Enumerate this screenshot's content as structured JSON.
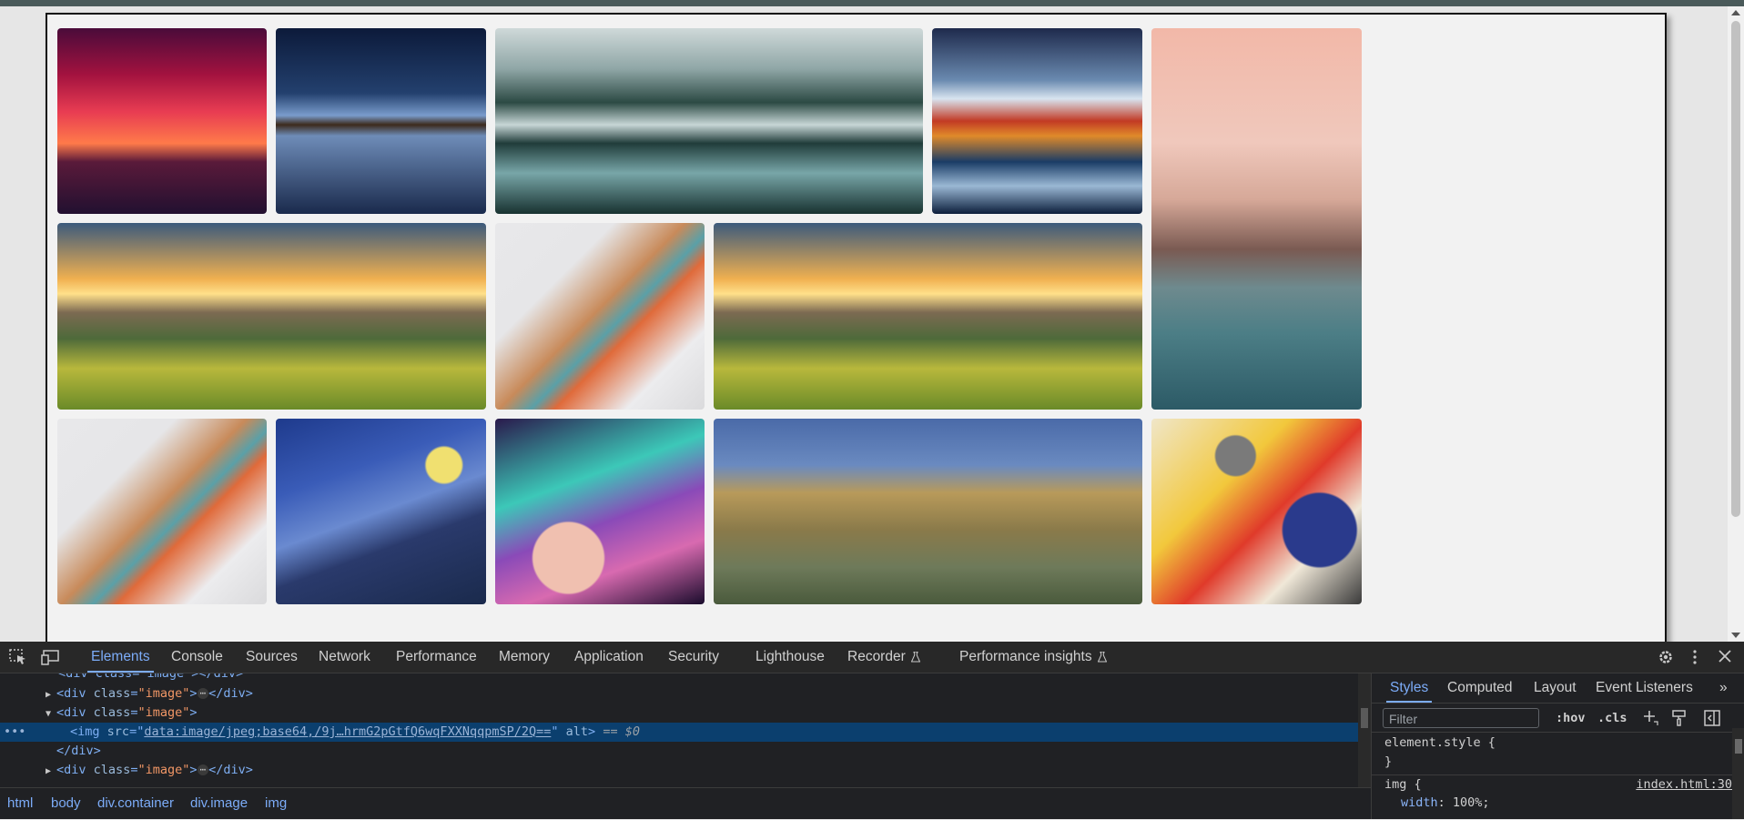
{
  "gallery": {
    "images": [
      {
        "name": "sunset-tree-image",
        "art": "im-sunset-tree"
      },
      {
        "name": "night-tree-reflection-image",
        "art": "im-night-tree"
      },
      {
        "name": "mountain-lake-reflection-image",
        "art": "im-lake-mtn"
      },
      {
        "name": "mount-fuji-lake-image",
        "art": "im-fuji"
      },
      {
        "name": "taj-mahal-image",
        "art": "im-taj"
      },
      {
        "name": "sunrise-meadow-image",
        "art": "im-meadow"
      },
      {
        "name": "reaching-hands-sketch-image",
        "art": "im-hands"
      },
      {
        "name": "sunrise-meadow-image-2",
        "art": "im-meadow"
      },
      {
        "name": "reaching-hands-sketch-image-2",
        "art": "im-hands"
      },
      {
        "name": "starry-night-image",
        "art": "im-starry"
      },
      {
        "name": "teal-haired-girl-image",
        "art": "im-girl"
      },
      {
        "name": "church-painting-image",
        "art": "im-church"
      },
      {
        "name": "kandinsky-abstract-image",
        "art": "im-kandinsky"
      }
    ]
  },
  "devtools": {
    "tabs": [
      "Elements",
      "Console",
      "Sources",
      "Network",
      "Performance",
      "Memory",
      "Application",
      "Security",
      "Lighthouse",
      "Recorder",
      "Performance insights"
    ],
    "active_tab": "Elements",
    "dom": {
      "line_partial": "<div class=\"image\"></div>",
      "div_open": "div",
      "class_attr": "class",
      "image_value": "\"image\"",
      "div_close": "</div>",
      "img_tag": "img",
      "src_attr": "src",
      "src_value": "data:image/jpeg;base64,/9j…hrmG2pGtfQ6wqFXXNqqpmSP/2Q==",
      "alt_attr": "alt",
      "eq_dollar": "== $0",
      "ellipsis": "⋯"
    },
    "breadcrumbs": [
      "html",
      "body",
      "div.container",
      "div.image",
      "img"
    ],
    "styles_panel": {
      "tabs": [
        "Styles",
        "Computed",
        "Layout",
        "Event Listeners"
      ],
      "active_tab": "Styles",
      "filter_placeholder": "Filter",
      "hov": ":hov",
      "cls": ".cls",
      "element_style_selector": "element.style {",
      "close_brace": "}",
      "img_selector": "img {",
      "source_link": "index.html:30",
      "width_prop": "width",
      "width_value": "100%;"
    }
  }
}
